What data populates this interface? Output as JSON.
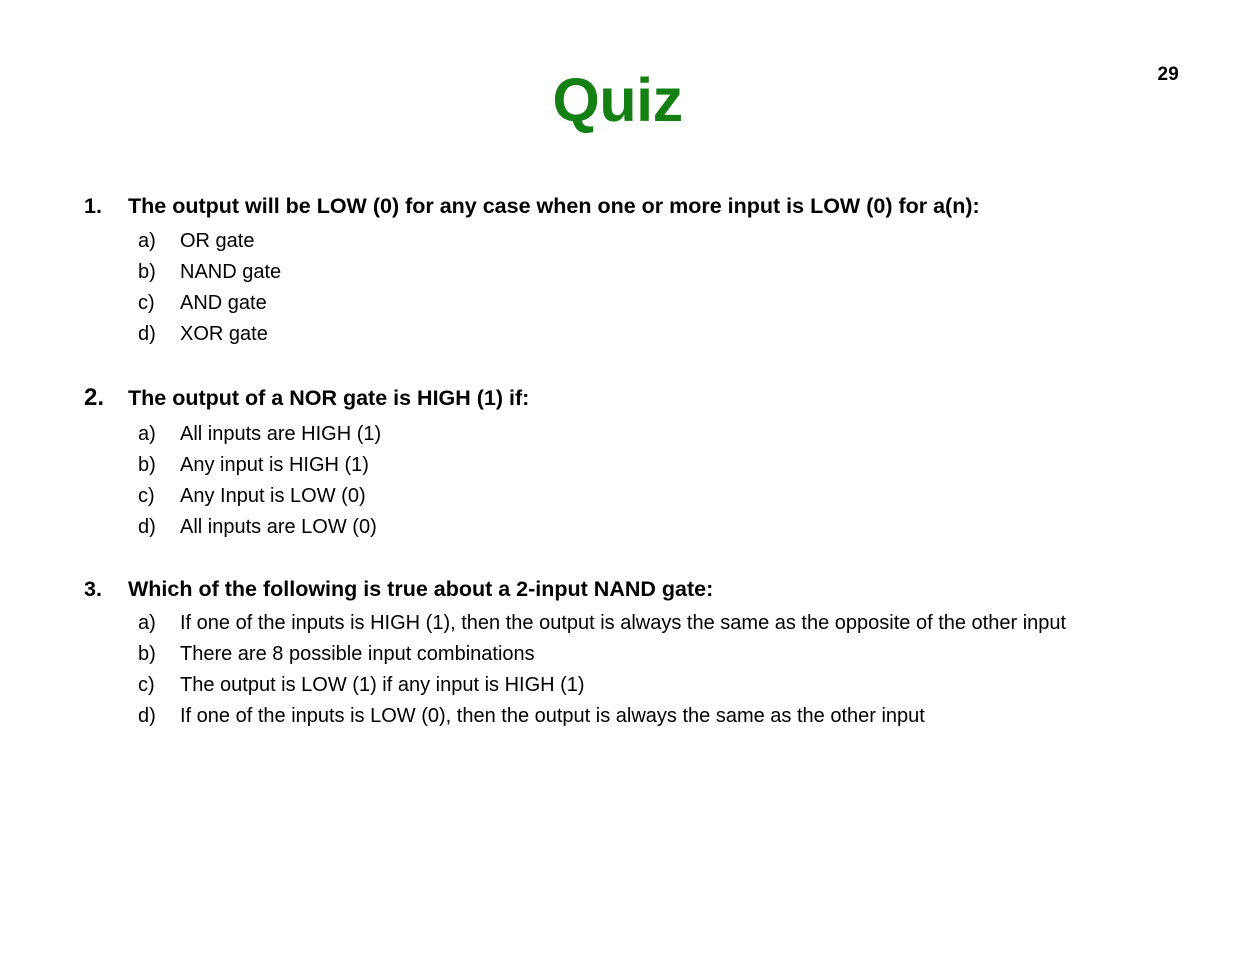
{
  "slide": {
    "page_number": "29",
    "title": "Quiz",
    "title_color": "#148013",
    "background_color": "#FFFFFF",
    "text_color": "#000000"
  },
  "questions": [
    {
      "number": "1.",
      "number_emphasis": false,
      "text": "The output will be LOW (0) for any case when one or more input is LOW (0) for a(n):",
      "options": [
        {
          "letter": "a)",
          "text": "OR gate"
        },
        {
          "letter": "b)",
          "text": "NAND gate"
        },
        {
          "letter": "c)",
          "text": "AND gate"
        },
        {
          "letter": "d)",
          "text": "XOR gate"
        }
      ]
    },
    {
      "number": "2.",
      "number_emphasis": true,
      "text": "The output of a NOR gate is HIGH (1) if:",
      "options": [
        {
          "letter": "a)",
          "text": "All inputs are HIGH (1)"
        },
        {
          "letter": "b)",
          "text": "Any input is HIGH (1)"
        },
        {
          "letter": "c)",
          "text": "Any Input is LOW (0)"
        },
        {
          "letter": "d)",
          "text": "All inputs are LOW (0)"
        }
      ]
    },
    {
      "number": "3.",
      "number_emphasis": false,
      "text": "Which of the following is true about a 2-input NAND gate:",
      "options": [
        {
          "letter": "a)",
          "text": "If one of the inputs is HIGH (1), then the output is always the same as the opposite of the other input"
        },
        {
          "letter": "b)",
          "text": "There are 8 possible input combinations"
        },
        {
          "letter": "c)",
          "text": "The output is LOW (1) if any input is HIGH (1)"
        },
        {
          "letter": "d)",
          "text": "If one of the inputs is LOW (0), then the output is always the same as the other input"
        }
      ]
    }
  ]
}
